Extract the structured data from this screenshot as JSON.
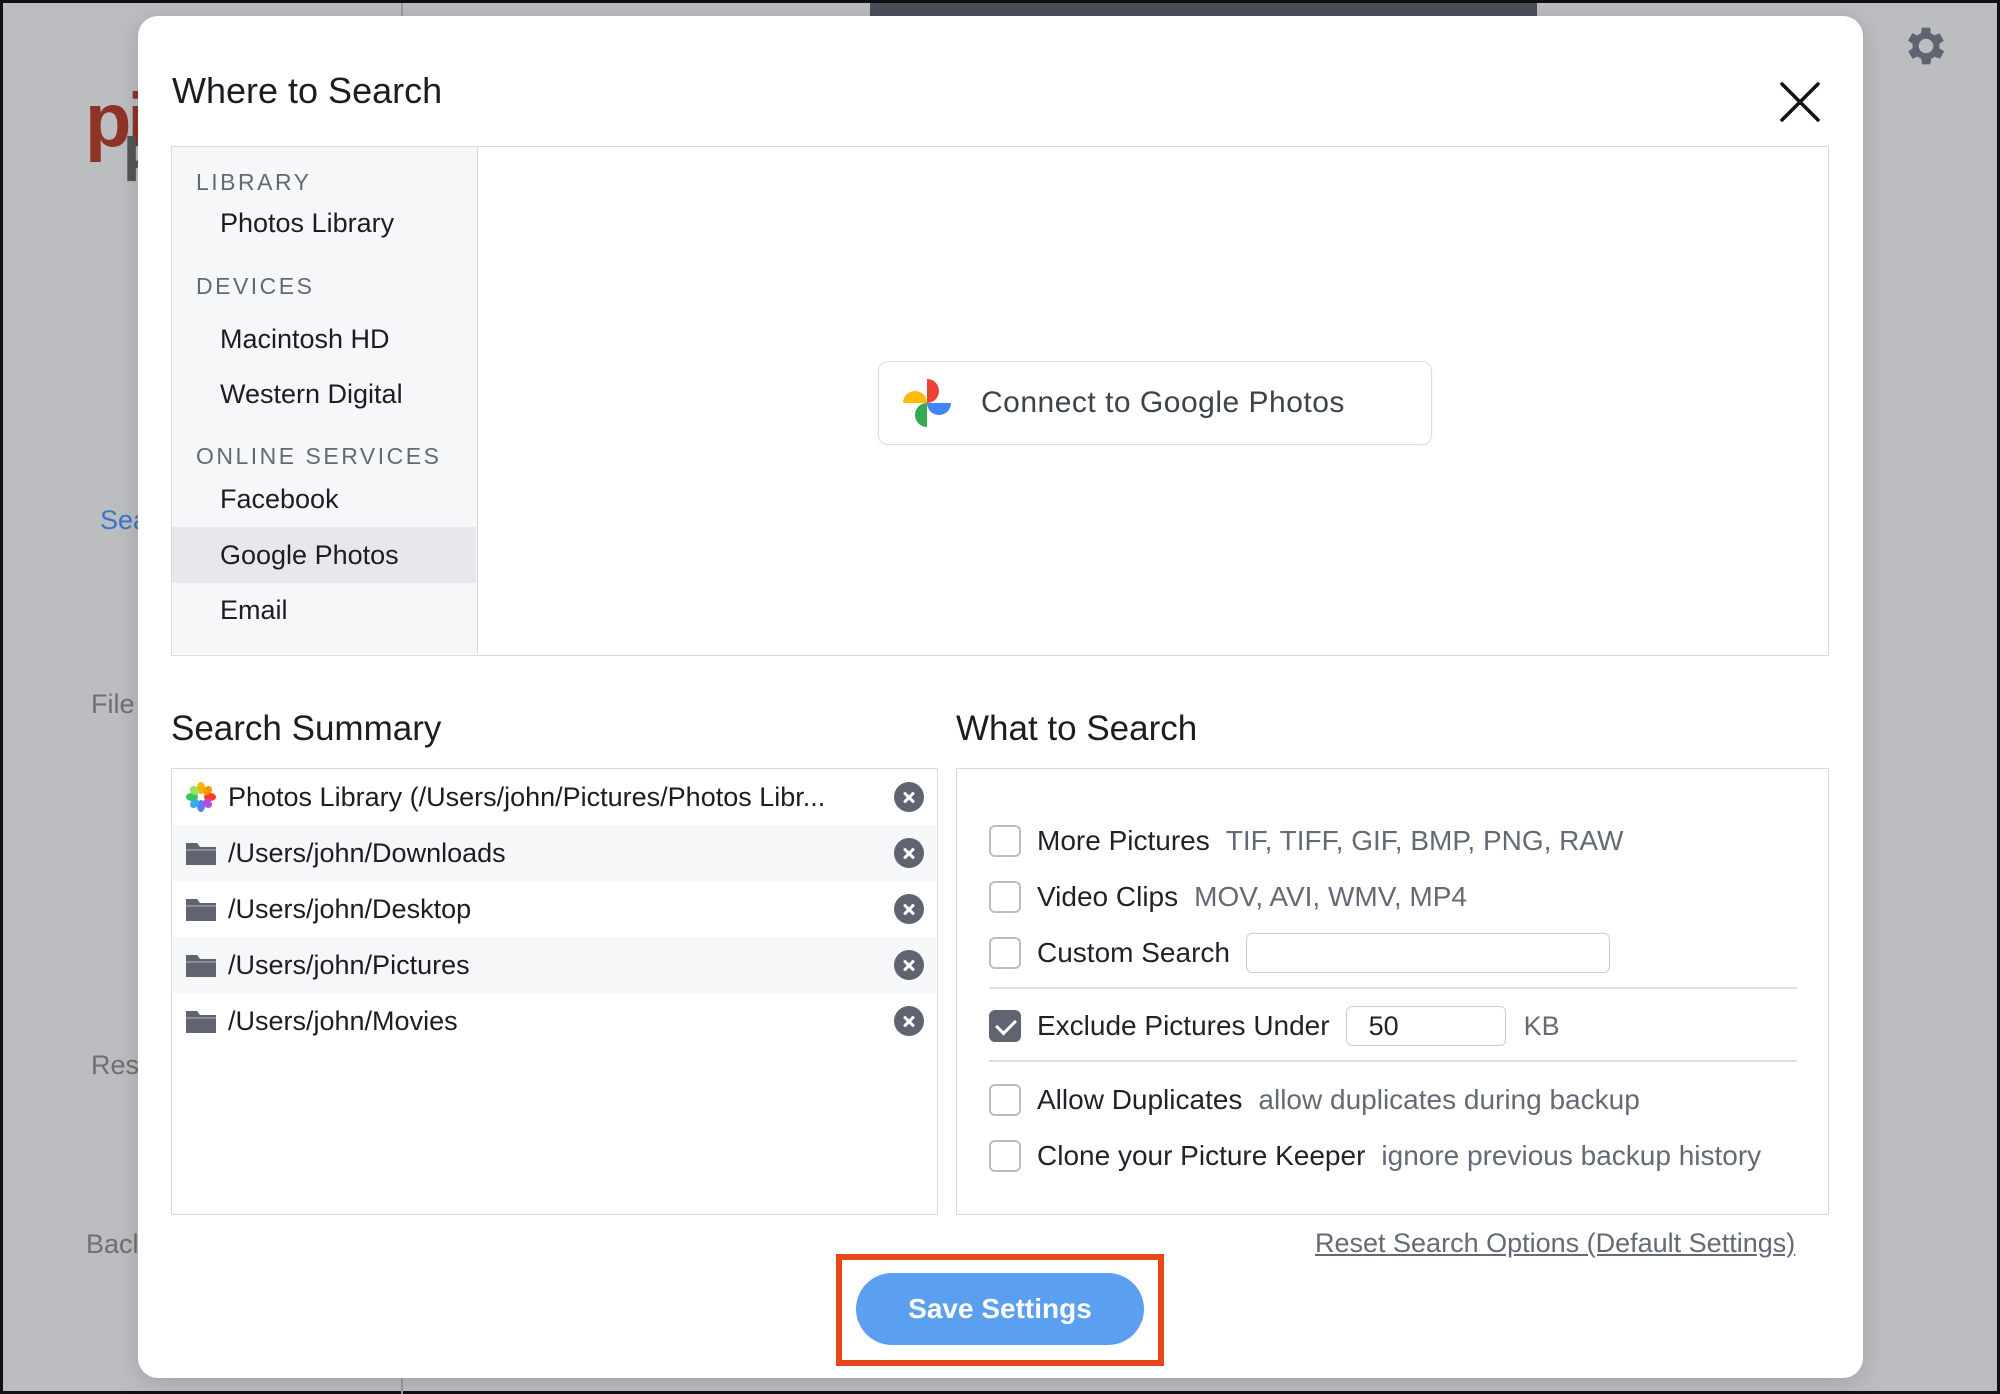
{
  "background": {
    "nav": [
      "Sea",
      "File",
      "Res",
      "Bacl"
    ]
  },
  "modal": {
    "title": "Where to Search",
    "sources": {
      "library_header": "LIBRARY",
      "library_items": [
        "Photos Library"
      ],
      "devices_header": "DEVICES",
      "devices_items": [
        "Macintosh HD",
        "Western Digital"
      ],
      "online_header": "ONLINE SERVICES",
      "online_items": [
        "Facebook",
        "Google Photos",
        "Email"
      ],
      "selected": "Google Photos"
    },
    "connect_button": "Connect to Google Photos",
    "summary": {
      "title": "Search Summary",
      "rows": [
        {
          "icon": "photos-app-icon",
          "text": "Photos Library (/Users/john/Pictures/Photos Libr..."
        },
        {
          "icon": "folder-icon",
          "text": "/Users/john/Downloads"
        },
        {
          "icon": "folder-icon",
          "text": "/Users/john/Desktop"
        },
        {
          "icon": "folder-icon",
          "text": "/Users/john/Pictures"
        },
        {
          "icon": "folder-icon",
          "text": "/Users/john/Movies"
        }
      ]
    },
    "what": {
      "title": "What to Search",
      "more_pictures": {
        "label": "More Pictures",
        "desc": "TIF, TIFF, GIF, BMP, PNG, RAW",
        "checked": false
      },
      "video_clips": {
        "label": "Video Clips",
        "desc": "MOV, AVI, WMV, MP4",
        "checked": false
      },
      "custom_search": {
        "label": "Custom Search",
        "value": "",
        "checked": false
      },
      "exclude": {
        "label": "Exclude Pictures Under",
        "value": "50",
        "unit": "KB",
        "checked": true
      },
      "allow_duplicates": {
        "label": "Allow Duplicates",
        "desc": "allow duplicates during backup",
        "checked": false
      },
      "clone": {
        "label": "Clone your Picture Keeper",
        "desc": "ignore previous backup history",
        "checked": false
      }
    },
    "reset_link": "Reset Search Options (Default Settings)",
    "save_button": "Save Settings",
    "colors": {
      "accent": "#5a9ff0",
      "highlight": "#e8471d"
    }
  }
}
